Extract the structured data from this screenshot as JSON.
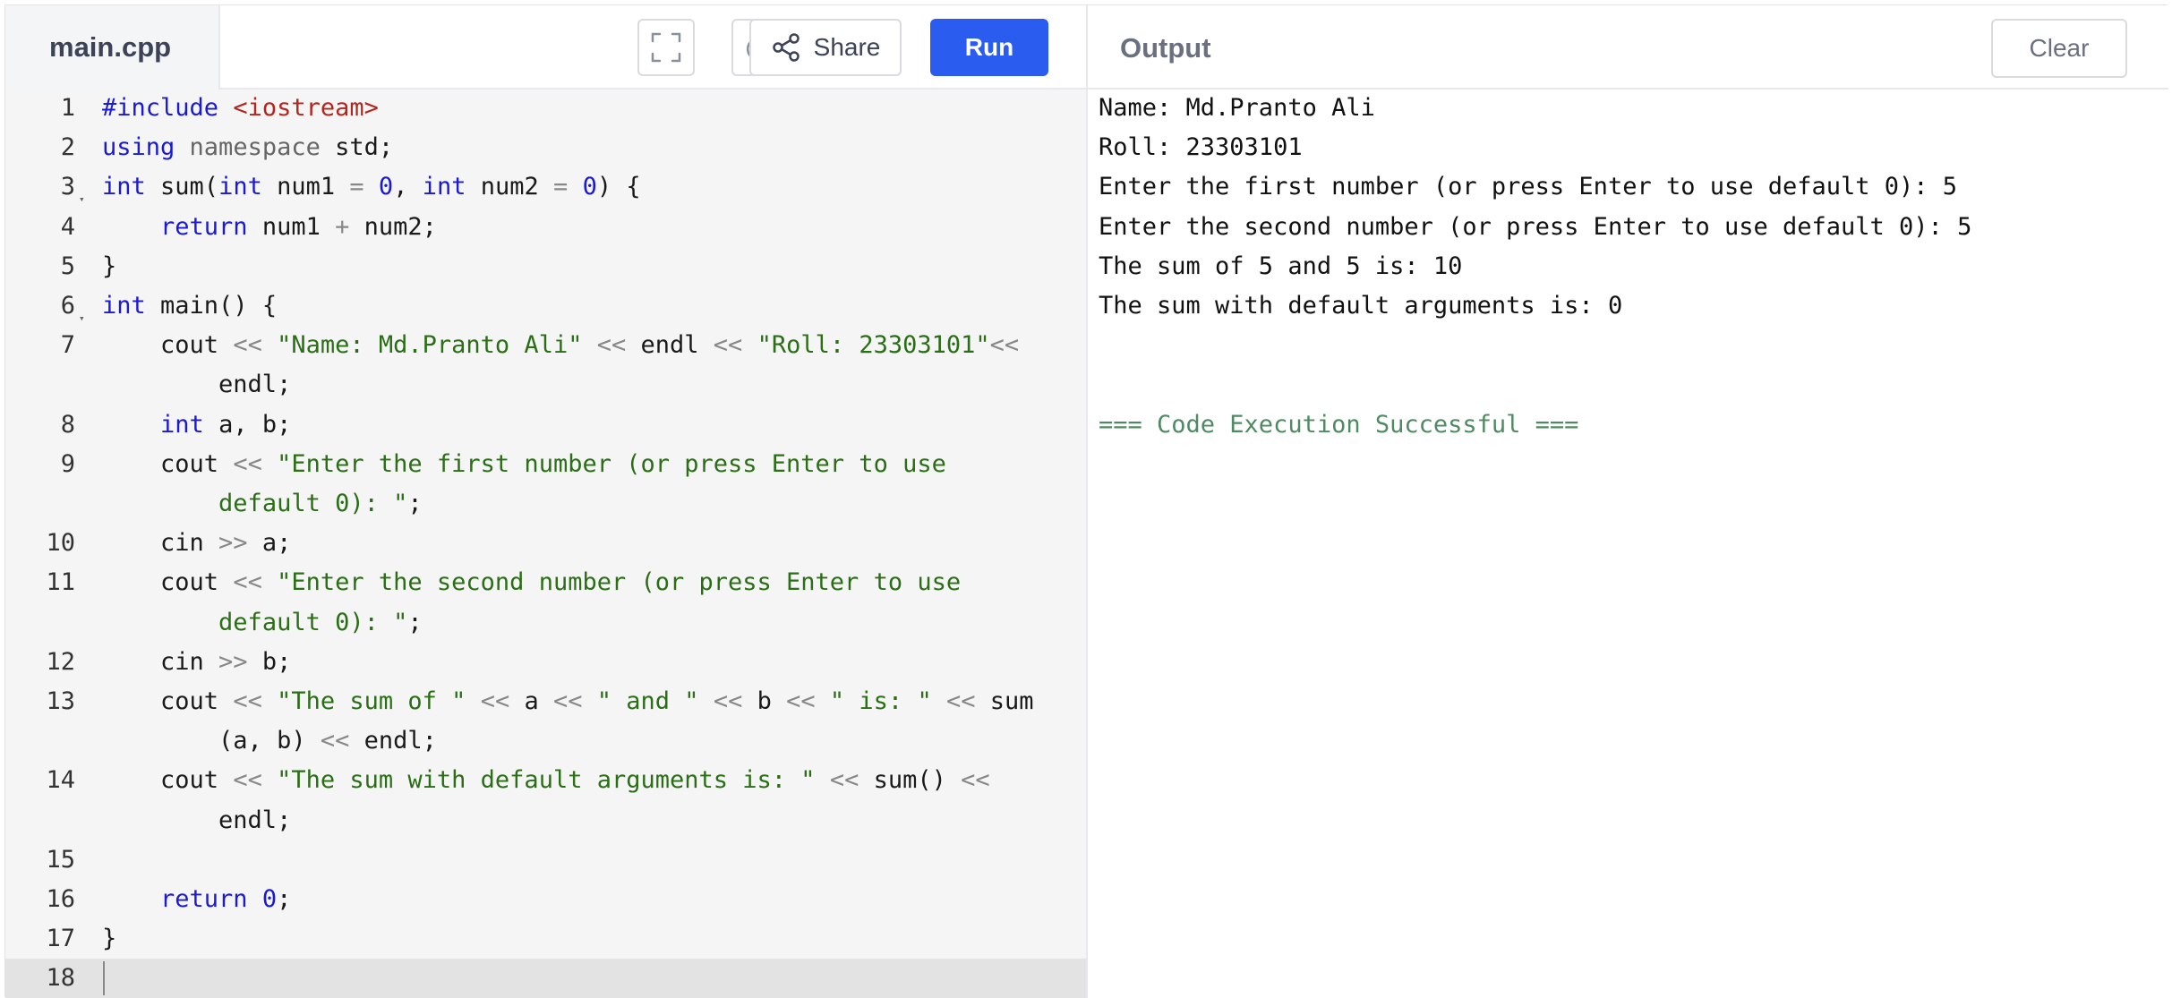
{
  "editor": {
    "filename": "main.cpp",
    "share_label": "Share",
    "run_label": "Run"
  },
  "output": {
    "title": "Output",
    "clear_label": "Clear",
    "lines": [
      "Name: Md.Pranto Ali",
      "Roll: 23303101",
      "Enter the first number (or press Enter to use default 0): 5",
      "Enter the second number (or press Enter to use default 0): 5",
      "The sum of 5 and 5 is: 10",
      "The sum with default arguments is: 0"
    ],
    "status": "=== Code Execution Successful ==="
  },
  "code": {
    "line_numbers": [
      "1",
      "2",
      "3",
      "4",
      "5",
      "6",
      "7",
      "8",
      "9",
      "10",
      "11",
      "12",
      "13",
      "14",
      "15",
      "16",
      "17",
      "18"
    ],
    "lines": [
      [
        {
          "t": "#include ",
          "c": "kw"
        },
        {
          "t": "<iostream>",
          "c": "inc"
        }
      ],
      [
        {
          "t": "using",
          "c": "kw"
        },
        {
          "t": " "
        },
        {
          "t": "namespace",
          "c": "ns"
        },
        {
          "t": " std;"
        }
      ],
      [
        {
          "t": "int",
          "c": "kw"
        },
        {
          "t": " sum("
        },
        {
          "t": "int",
          "c": "kw"
        },
        {
          "t": " num1 "
        },
        {
          "t": "=",
          "c": "op"
        },
        {
          "t": " "
        },
        {
          "t": "0",
          "c": "num"
        },
        {
          "t": ", "
        },
        {
          "t": "int",
          "c": "kw"
        },
        {
          "t": " num2 "
        },
        {
          "t": "=",
          "c": "op"
        },
        {
          "t": " "
        },
        {
          "t": "0",
          "c": "num"
        },
        {
          "t": ") {"
        }
      ],
      [
        {
          "t": "    "
        },
        {
          "t": "return",
          "c": "kw"
        },
        {
          "t": " num1 "
        },
        {
          "t": "+",
          "c": "op"
        },
        {
          "t": " num2;"
        }
      ],
      [
        {
          "t": "}"
        }
      ],
      [
        {
          "t": "int",
          "c": "kw"
        },
        {
          "t": " main() {"
        }
      ],
      [
        {
          "t": "    cout "
        },
        {
          "t": "<<",
          "c": "op"
        },
        {
          "t": " "
        },
        {
          "t": "\"Name: Md.Pranto Ali\"",
          "c": "str"
        },
        {
          "t": " "
        },
        {
          "t": "<<",
          "c": "op"
        },
        {
          "t": " endl "
        },
        {
          "t": "<<",
          "c": "op"
        },
        {
          "t": " "
        },
        {
          "t": "\"Roll: 23303101\"",
          "c": "str"
        },
        {
          "t": "<<",
          "c": "op"
        }
      ],
      [
        {
          "t": "        endl;"
        }
      ],
      [
        {
          "t": "    "
        },
        {
          "t": "int",
          "c": "kw"
        },
        {
          "t": " a, b;"
        }
      ],
      [
        {
          "t": "    cout "
        },
        {
          "t": "<<",
          "c": "op"
        },
        {
          "t": " "
        },
        {
          "t": "\"Enter the first number (or press Enter to use",
          "c": "str"
        }
      ],
      [
        {
          "t": "        "
        },
        {
          "t": "default 0): \"",
          "c": "str"
        },
        {
          "t": ";"
        }
      ],
      [
        {
          "t": "    cin "
        },
        {
          "t": ">>",
          "c": "op"
        },
        {
          "t": " a;"
        }
      ],
      [
        {
          "t": "    cout "
        },
        {
          "t": "<<",
          "c": "op"
        },
        {
          "t": " "
        },
        {
          "t": "\"Enter the second number (or press Enter to use",
          "c": "str"
        }
      ],
      [
        {
          "t": "        "
        },
        {
          "t": "default 0): \"",
          "c": "str"
        },
        {
          "t": ";"
        }
      ],
      [
        {
          "t": "    cin "
        },
        {
          "t": ">>",
          "c": "op"
        },
        {
          "t": " b;"
        }
      ],
      [
        {
          "t": "    cout "
        },
        {
          "t": "<<",
          "c": "op"
        },
        {
          "t": " "
        },
        {
          "t": "\"The sum of \"",
          "c": "str"
        },
        {
          "t": " "
        },
        {
          "t": "<<",
          "c": "op"
        },
        {
          "t": " a "
        },
        {
          "t": "<<",
          "c": "op"
        },
        {
          "t": " "
        },
        {
          "t": "\" and \"",
          "c": "str"
        },
        {
          "t": " "
        },
        {
          "t": "<<",
          "c": "op"
        },
        {
          "t": " b "
        },
        {
          "t": "<<",
          "c": "op"
        },
        {
          "t": " "
        },
        {
          "t": "\" is: \"",
          "c": "str"
        },
        {
          "t": " "
        },
        {
          "t": "<<",
          "c": "op"
        },
        {
          "t": " sum"
        }
      ],
      [
        {
          "t": "        (a, b) "
        },
        {
          "t": "<<",
          "c": "op"
        },
        {
          "t": " endl;"
        }
      ],
      [
        {
          "t": "    cout "
        },
        {
          "t": "<<",
          "c": "op"
        },
        {
          "t": " "
        },
        {
          "t": "\"The sum with default arguments is: \"",
          "c": "str"
        },
        {
          "t": " "
        },
        {
          "t": "<<",
          "c": "op"
        },
        {
          "t": " sum() "
        },
        {
          "t": "<<",
          "c": "op"
        }
      ],
      [
        {
          "t": "        endl;"
        }
      ],
      [],
      [
        {
          "t": "    "
        },
        {
          "t": "return",
          "c": "kw"
        },
        {
          "t": " "
        },
        {
          "t": "0",
          "c": "num"
        },
        {
          "t": ";"
        }
      ],
      [
        {
          "t": "}"
        }
      ],
      []
    ]
  }
}
